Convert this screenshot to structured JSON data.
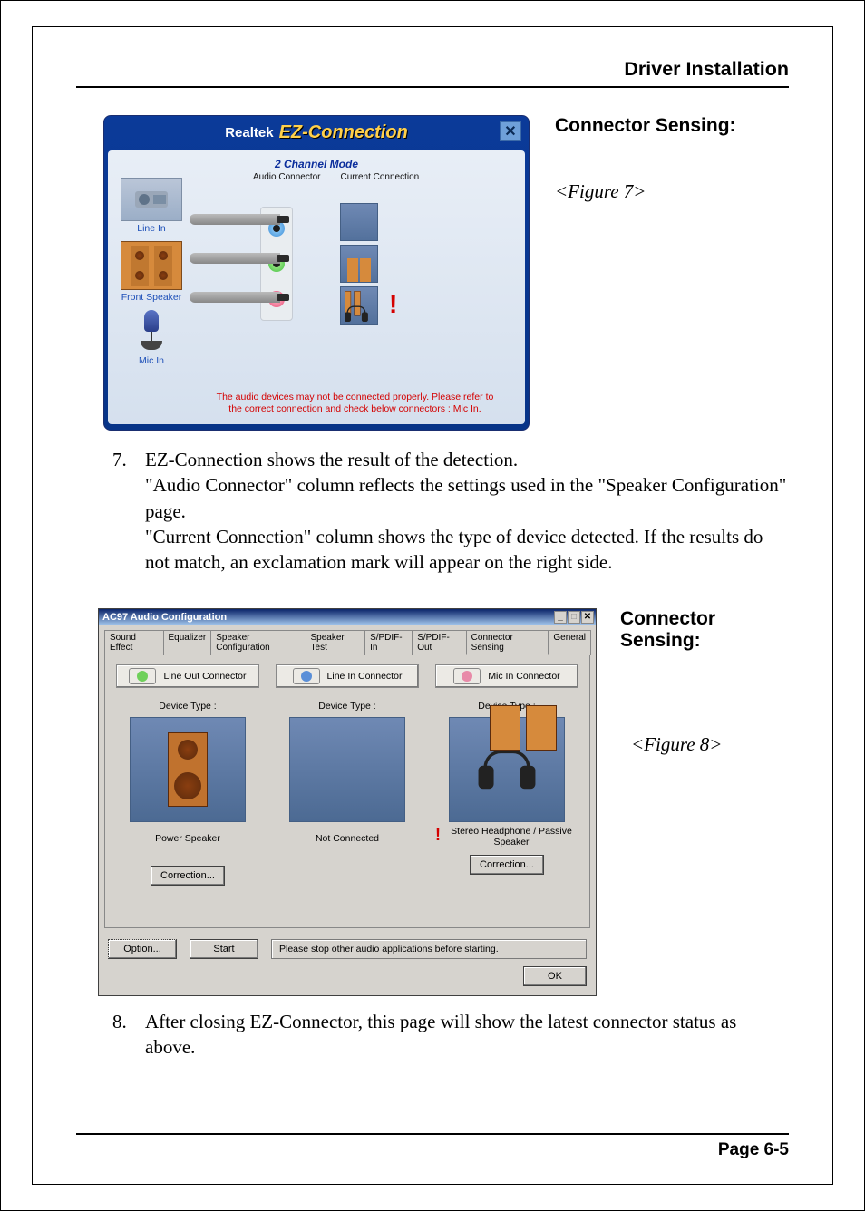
{
  "page_header": "Driver Installation",
  "page_footer": "Page 6-5",
  "fig7": {
    "side_title": "Connector Sensing:",
    "caption": "<Figure 7>",
    "window": {
      "brand": "Realtek",
      "product": "EZ-Connection",
      "close": "✕",
      "mode": "2 Channel Mode",
      "col1": "Audio Connector",
      "col2": "Current Connection",
      "left_labels": {
        "line_in": "Line In",
        "front_spk": "Front Speaker",
        "mic_in": "Mic In"
      },
      "warning": "The audio devices may not be connected properly. Please refer to the correct connection and check below connectors : Mic In."
    }
  },
  "item7": {
    "num": "7.",
    "p1": "EZ-Connection shows the result of the detection.",
    "p2": "\"Audio Connector\" column reflects the settings used in the \"Speaker Configuration\" page.",
    "p3": "\"Current Connection\" column shows the type of device detected. If the results do not match, an exclamation mark will appear on the right side."
  },
  "fig8": {
    "side_title": "Connector Sensing:",
    "caption": "<Figure 8>",
    "window": {
      "titlebar": "AC97 Audio Configuration",
      "tabs": [
        "Sound Effect",
        "Equalizer",
        "Speaker Configuration",
        "Speaker Test",
        "S/PDIF-In",
        "S/PDIF-Out",
        "Connector Sensing",
        "General"
      ],
      "active_tab_index": 6,
      "columns": [
        {
          "connector": "Line Out Connector",
          "jack_color": "#6fd05a",
          "device_type_label": "Device Type :",
          "result": "Power Speaker",
          "correction": "Correction...",
          "has_excl": false
        },
        {
          "connector": "Line In Connector",
          "jack_color": "#5a8fd8",
          "device_type_label": "Device Type :",
          "result": "Not Connected",
          "correction": "",
          "has_excl": false
        },
        {
          "connector": "Mic In Connector",
          "jack_color": "#e88aa8",
          "device_type_label": "Device Type :",
          "result": "Stereo Headphone / Passive Speaker",
          "correction": "Correction...",
          "has_excl": true
        }
      ],
      "option_btn": "Option...",
      "start_btn": "Start",
      "hint": "Please stop other audio applications before starting.",
      "ok_btn": "OK"
    }
  },
  "item8": {
    "num": "8.",
    "p1": "After closing EZ-Connector, this page will show the latest connector status as above."
  }
}
